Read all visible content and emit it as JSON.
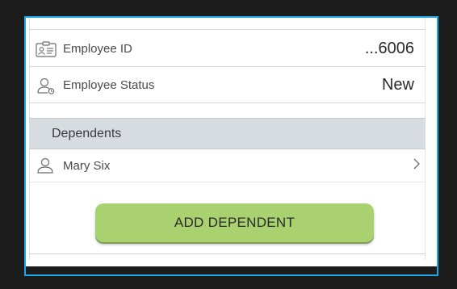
{
  "employee_id": {
    "label": "Employee ID",
    "value": "...6006",
    "icon": "id-card-icon"
  },
  "employee_status": {
    "label": "Employee Status",
    "value": "New",
    "icon": "person-status-icon"
  },
  "dependents": {
    "section_title": "Dependents",
    "items": [
      {
        "name": "Mary Six",
        "icon": "person-icon"
      }
    ],
    "add_button_label": "ADD DEPENDENT"
  },
  "colors": {
    "accent_border": "#1ea7e6",
    "section_bg": "#d7dce1",
    "button_bg": "#a9d170"
  }
}
